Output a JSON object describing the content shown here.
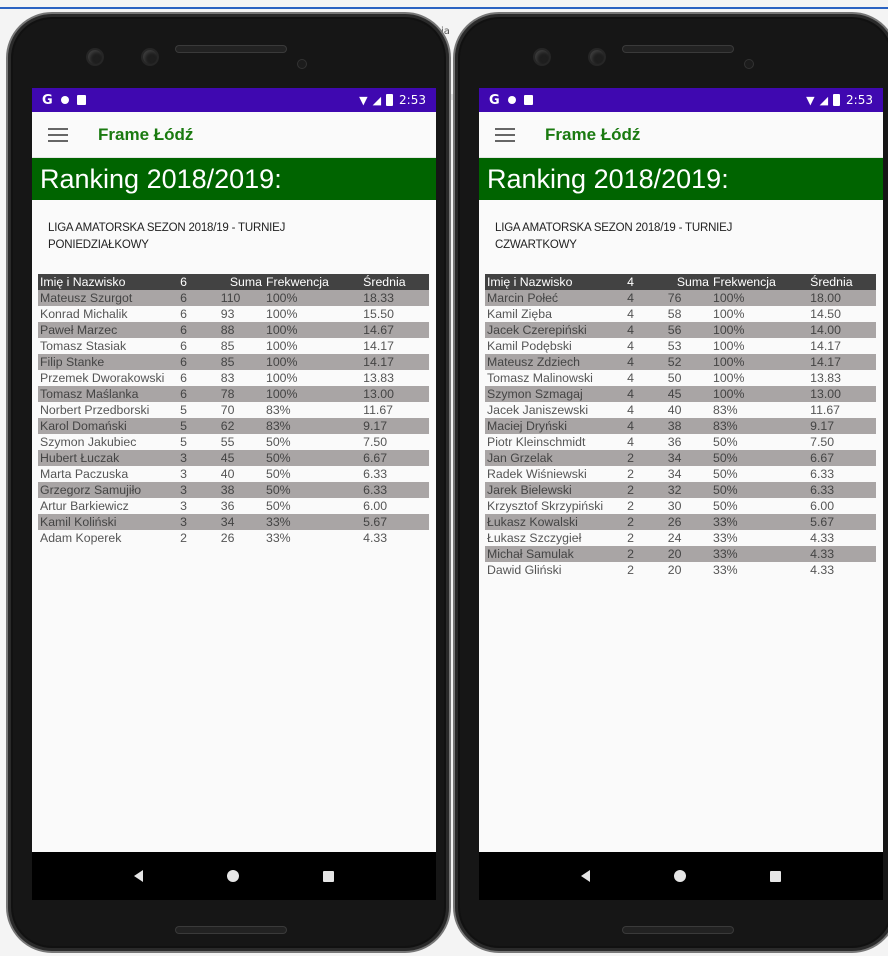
{
  "background": {
    "partial_text": "ja"
  },
  "phones": [
    {
      "status": {
        "g_icon": "G",
        "time": "2:53"
      },
      "appbar": {
        "title": "Frame Łódź"
      },
      "banner": {
        "heading": "Ranking 2018/2019:"
      },
      "league": {
        "line1": "LIGA AMATORSKA SEZON 2018/19 - TURNIEJ",
        "line2": "PONIEDZIAŁKOWY"
      },
      "table": {
        "headers": [
          "Imię i Nazwisko",
          "6",
          "Suma",
          "Frekwencja",
          "Średnia"
        ],
        "rows": [
          [
            "Mateusz Szurgot",
            "6",
            "110",
            "100%",
            "18.33"
          ],
          [
            "Konrad Michalik",
            "6",
            "93",
            "100%",
            "15.50"
          ],
          [
            "Paweł Marzec",
            "6",
            "88",
            "100%",
            "14.67"
          ],
          [
            "Tomasz Stasiak",
            "6",
            "85",
            "100%",
            "14.17"
          ],
          [
            "Filip Stanke",
            "6",
            "85",
            "100%",
            "14.17"
          ],
          [
            "Przemek Dworakowski",
            "6",
            "83",
            "100%",
            "13.83"
          ],
          [
            "Tomasz Maślanka",
            "6",
            "78",
            "100%",
            "13.00"
          ],
          [
            "Norbert Przedborski",
            "5",
            "70",
            "83%",
            "11.67"
          ],
          [
            "Karol Domański",
            "5",
            "62",
            "83%",
            "9.17"
          ],
          [
            "Szymon Jakubiec",
            "5",
            "55",
            "50%",
            "7.50"
          ],
          [
            "Hubert Łuczak",
            "3",
            "45",
            "50%",
            "6.67"
          ],
          [
            "Marta Paczuska",
            "3",
            "40",
            "50%",
            "6.33"
          ],
          [
            "Grzegorz Samujiło",
            "3",
            "38",
            "50%",
            "6.33"
          ],
          [
            "Artur Barkiewicz",
            "3",
            "36",
            "50%",
            "6.00"
          ],
          [
            "Kamil Koliński",
            "3",
            "34",
            "33%",
            "5.67"
          ],
          [
            "Adam Koperek",
            "2",
            "26",
            "33%",
            "4.33"
          ]
        ]
      }
    },
    {
      "status": {
        "g_icon": "G",
        "time": "2:53"
      },
      "appbar": {
        "title": "Frame Łódź"
      },
      "banner": {
        "heading": "Ranking 2018/2019:"
      },
      "league": {
        "line1": "LIGA AMATORSKA SEZON 2018/19 - TURNIEJ",
        "line2": "CZWARTKOWY"
      },
      "table": {
        "headers": [
          "Imię i Nazwisko",
          "4",
          "Suma",
          "Frekwencja",
          "Średnia"
        ],
        "rows": [
          [
            "Marcin Połeć",
            "4",
            "76",
            "100%",
            "18.00"
          ],
          [
            "Kamil Zięba",
            "4",
            "58",
            "100%",
            "14.50"
          ],
          [
            "Jacek Czerepiński",
            "4",
            "56",
            "100%",
            "14.00"
          ],
          [
            "Kamil Podębski",
            "4",
            "53",
            "100%",
            "14.17"
          ],
          [
            "Mateusz Zdziech",
            "4",
            "52",
            "100%",
            "14.17"
          ],
          [
            "Tomasz Malinowski",
            "4",
            "50",
            "100%",
            "13.83"
          ],
          [
            "Szymon Szmagaj",
            "4",
            "45",
            "100%",
            "13.00"
          ],
          [
            "Jacek Janiszewski",
            "4",
            "40",
            "83%",
            "11.67"
          ],
          [
            "Maciej Dryński",
            "4",
            "38",
            "83%",
            "9.17"
          ],
          [
            "Piotr Kleinschmidt",
            "4",
            "36",
            "50%",
            "7.50"
          ],
          [
            "Jan Grzelak",
            "2",
            "34",
            "50%",
            "6.67"
          ],
          [
            "Radek Wiśniewski",
            "2",
            "34",
            "50%",
            "6.33"
          ],
          [
            "Jarek Bielewski",
            "2",
            "32",
            "50%",
            "6.33"
          ],
          [
            "Krzysztof Skrzypiński",
            "2",
            "30",
            "50%",
            "6.00"
          ],
          [
            "Łukasz Kowalski",
            "2",
            "26",
            "33%",
            "5.67"
          ],
          [
            "Łukasz Szczygieł",
            "2",
            "24",
            "33%",
            "4.33"
          ],
          [
            "Michał Samulak",
            "2",
            "20",
            "33%",
            "4.33"
          ],
          [
            "Dawid Gliński",
            "2",
            "20",
            "33%",
            "4.33"
          ]
        ]
      }
    }
  ]
}
